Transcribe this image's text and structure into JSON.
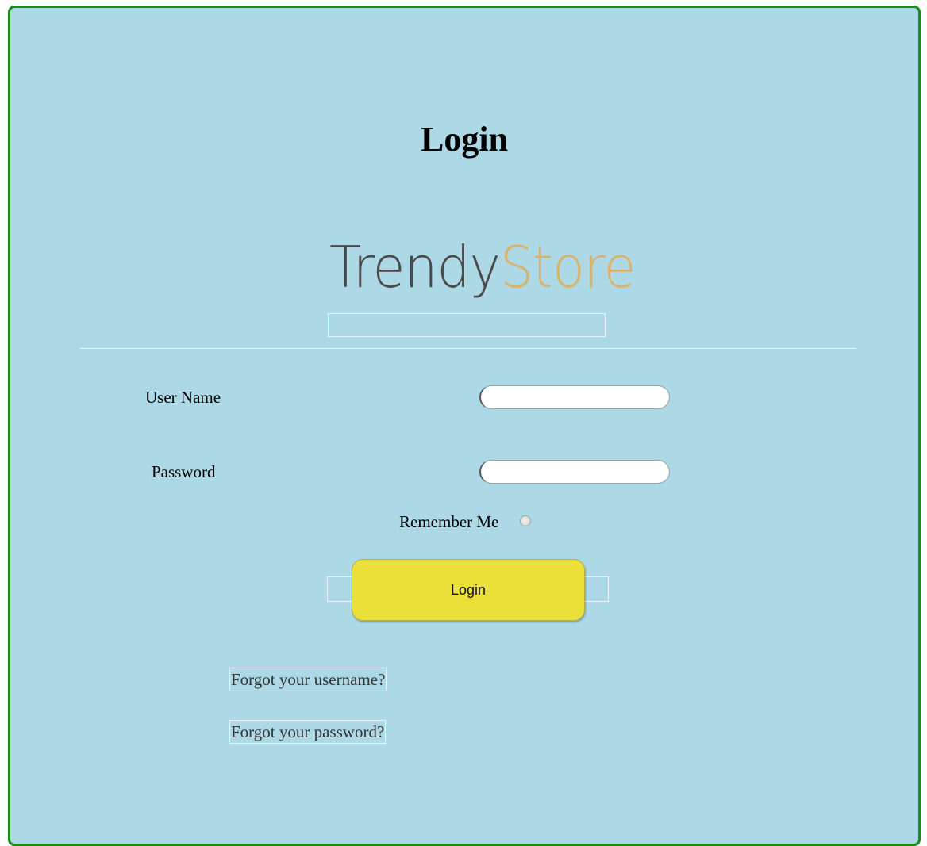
{
  "page": {
    "title": "Login"
  },
  "logo": {
    "part1": "Trendy",
    "part2": "Store"
  },
  "form": {
    "username_label": "User Name",
    "username_value": "",
    "password_label": "Password",
    "password_value": "",
    "remember_label": "Remember Me",
    "remember_checked": false,
    "login_label": "Login"
  },
  "links": {
    "forgot_username": "Forgot your username?",
    "forgot_password": "Forgot your password?"
  },
  "colors": {
    "panel_background": "#add8e6",
    "panel_border": "#1a8c1a",
    "button_background": "#ebdf39",
    "logo_primary": "#4a4a4a",
    "logo_accent": "#d9b36a"
  }
}
